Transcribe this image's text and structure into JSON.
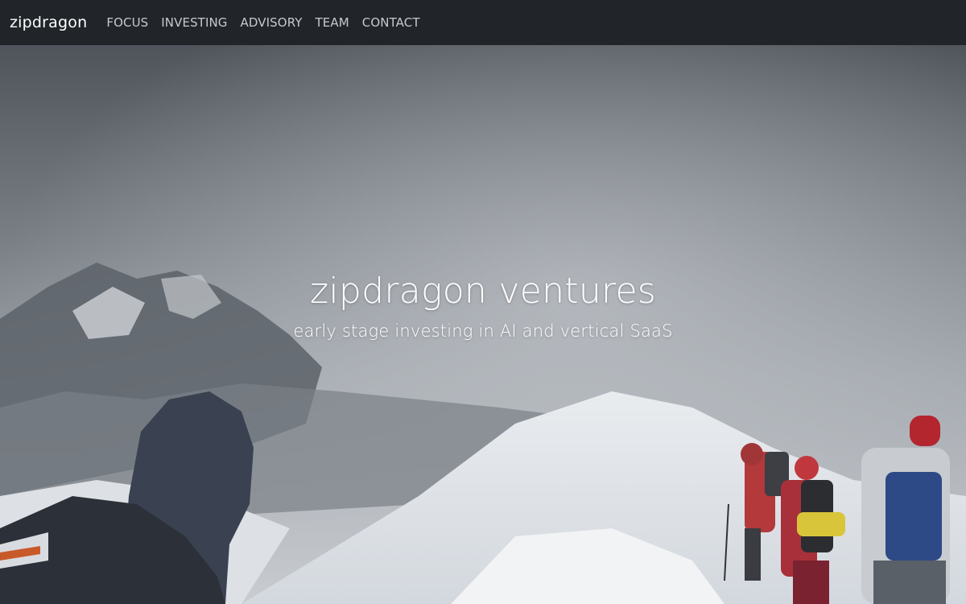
{
  "nav": {
    "brand": "zipdragon",
    "links": [
      "FOCUS",
      "INVESTING",
      "ADVISORY",
      "TEAM",
      "CONTACT"
    ]
  },
  "hero": {
    "title": "zipdragon ventures",
    "subtitle": "early stage investing in AI and vertical SaaS",
    "image": "snowy-mountain-ridge-hikers-photo"
  },
  "colors": {
    "navbar_bg": "#212529",
    "brand_text": "#ffffff",
    "nav_link_text": "#c7c9cc",
    "hero_text": "#ffffff"
  }
}
